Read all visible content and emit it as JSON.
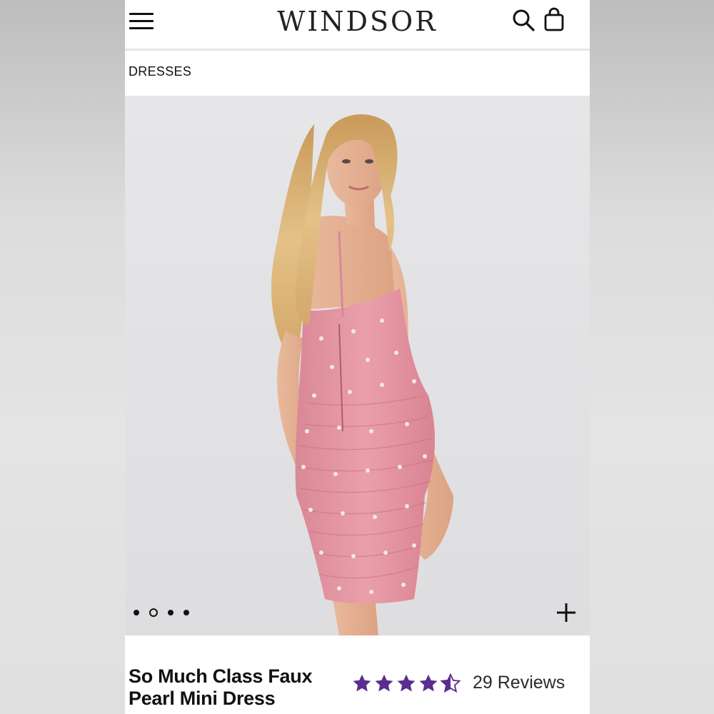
{
  "header": {
    "brand": "WINDSOR",
    "menu_icon": "hamburger-menu-icon",
    "search_icon": "search-icon",
    "bag_icon": "shopping-bag-icon"
  },
  "breadcrumb": {
    "label": "DRESSES"
  },
  "gallery": {
    "image_count": 4,
    "active_index": 1,
    "zoom_icon": "plus-icon"
  },
  "product": {
    "name": "So Much Class Faux Pearl Mini Dress",
    "rating": 4.5,
    "reviews_label": "29 Reviews",
    "star_color": "#5b2d8e"
  },
  "colors": {
    "background": "#ffffff",
    "hero_bg": "#e4e4e6",
    "dress_pink": "#e39aa6",
    "text": "#111111"
  }
}
